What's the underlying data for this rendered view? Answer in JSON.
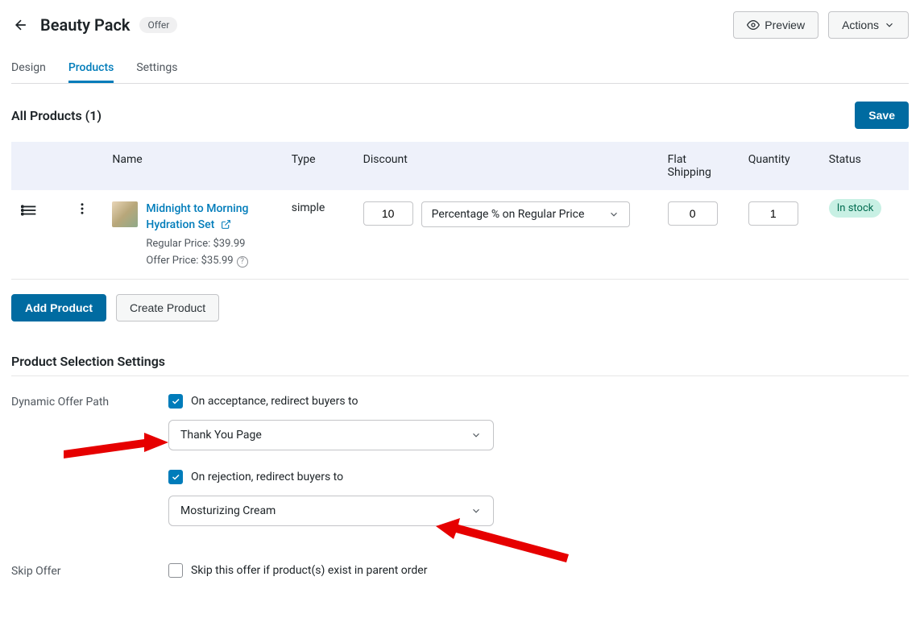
{
  "header": {
    "title": "Beauty Pack",
    "badge": "Offer",
    "preview": "Preview",
    "actions": "Actions"
  },
  "tabs": {
    "design": "Design",
    "products": "Products",
    "settings": "Settings"
  },
  "products": {
    "title": "All Products (1)",
    "save": "Save",
    "columns": {
      "name": "Name",
      "type": "Type",
      "discount": "Discount",
      "flat": "Flat Shipping",
      "qty": "Quantity",
      "status": "Status"
    },
    "row": {
      "name": "Midnight to Morning Hydration Set",
      "regular_label": "Regular Price: ",
      "regular_price": "$39.99",
      "offer_label": "Offer Price: ",
      "offer_price": "$35.99",
      "type": "simple",
      "discount_value": "10",
      "discount_type": "Percentage % on Regular Price",
      "flat": "0",
      "qty": "1",
      "status": "In stock"
    },
    "add_product": "Add Product",
    "create_product": "Create Product"
  },
  "settings_section": {
    "title": "Product Selection Settings",
    "dynamic_label": "Dynamic Offer Path",
    "accept_label": "On acceptance, redirect buyers to",
    "accept_value": "Thank You Page",
    "reject_label": "On rejection, redirect buyers to",
    "reject_value": "Mosturizing Cream",
    "skip_label": "Skip Offer",
    "skip_text": "Skip this offer if product(s) exist in parent order"
  }
}
